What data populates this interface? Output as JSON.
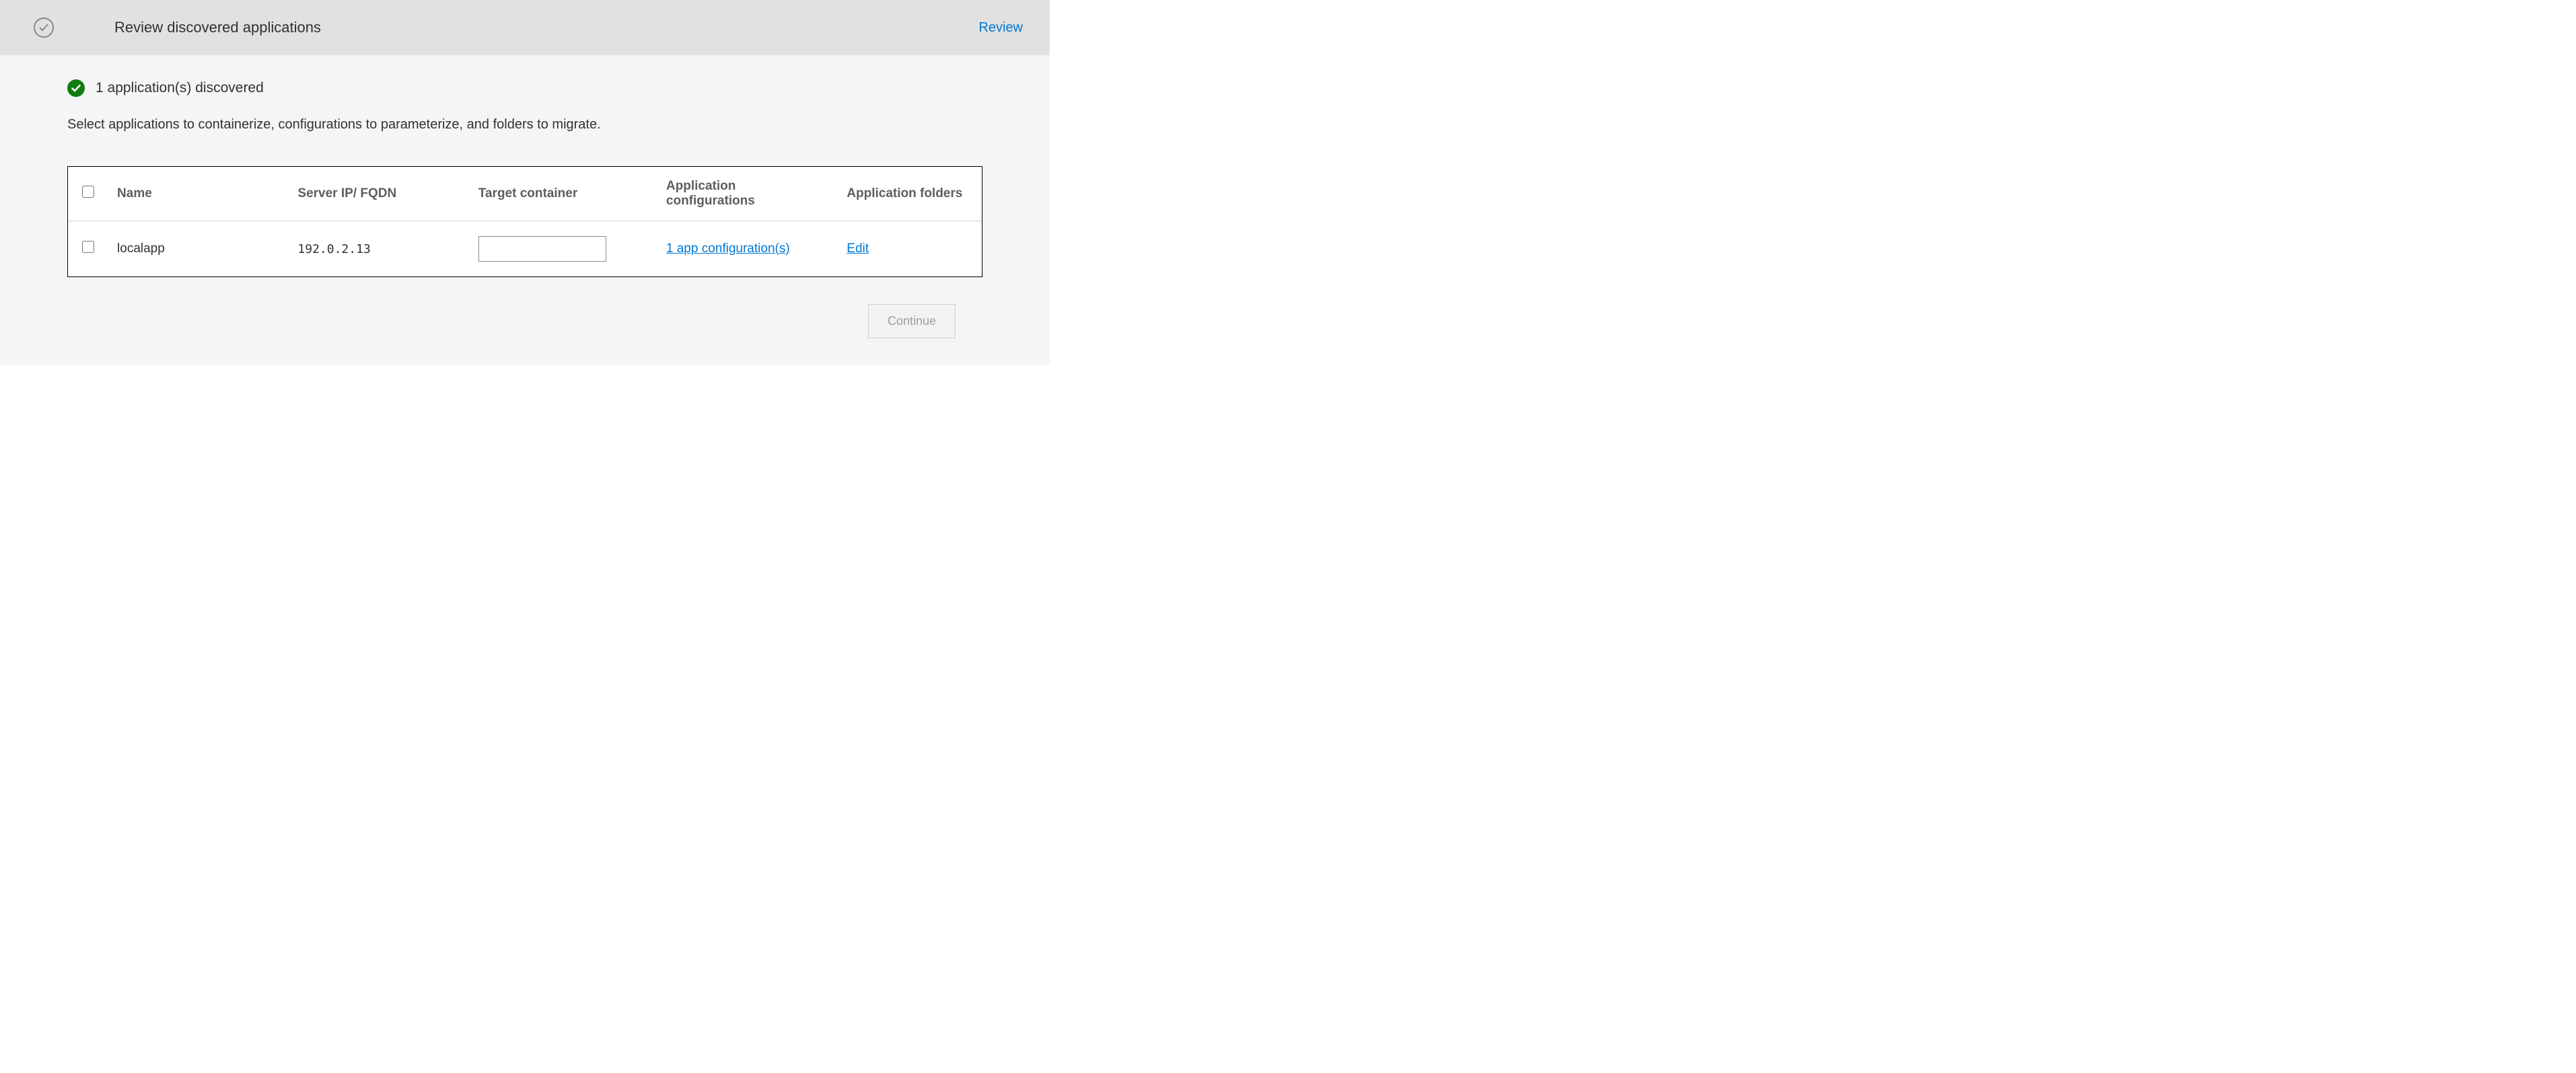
{
  "header": {
    "title": "Review discovered applications",
    "action": "Review"
  },
  "status": {
    "text": "1 application(s) discovered"
  },
  "instruction": "Select applications to containerize, configurations to parameterize, and folders to migrate.",
  "table": {
    "headers": {
      "name": "Name",
      "ip": "Server IP/ FQDN",
      "target": "Target container",
      "config": "Application configurations",
      "folders": "Application folders"
    },
    "rows": [
      {
        "name": "localapp",
        "ip": "192.0.2.13",
        "target": "",
        "config_link": "1 app configuration(s)",
        "folders_link": "Edit"
      }
    ]
  },
  "footer": {
    "continue": "Continue"
  }
}
